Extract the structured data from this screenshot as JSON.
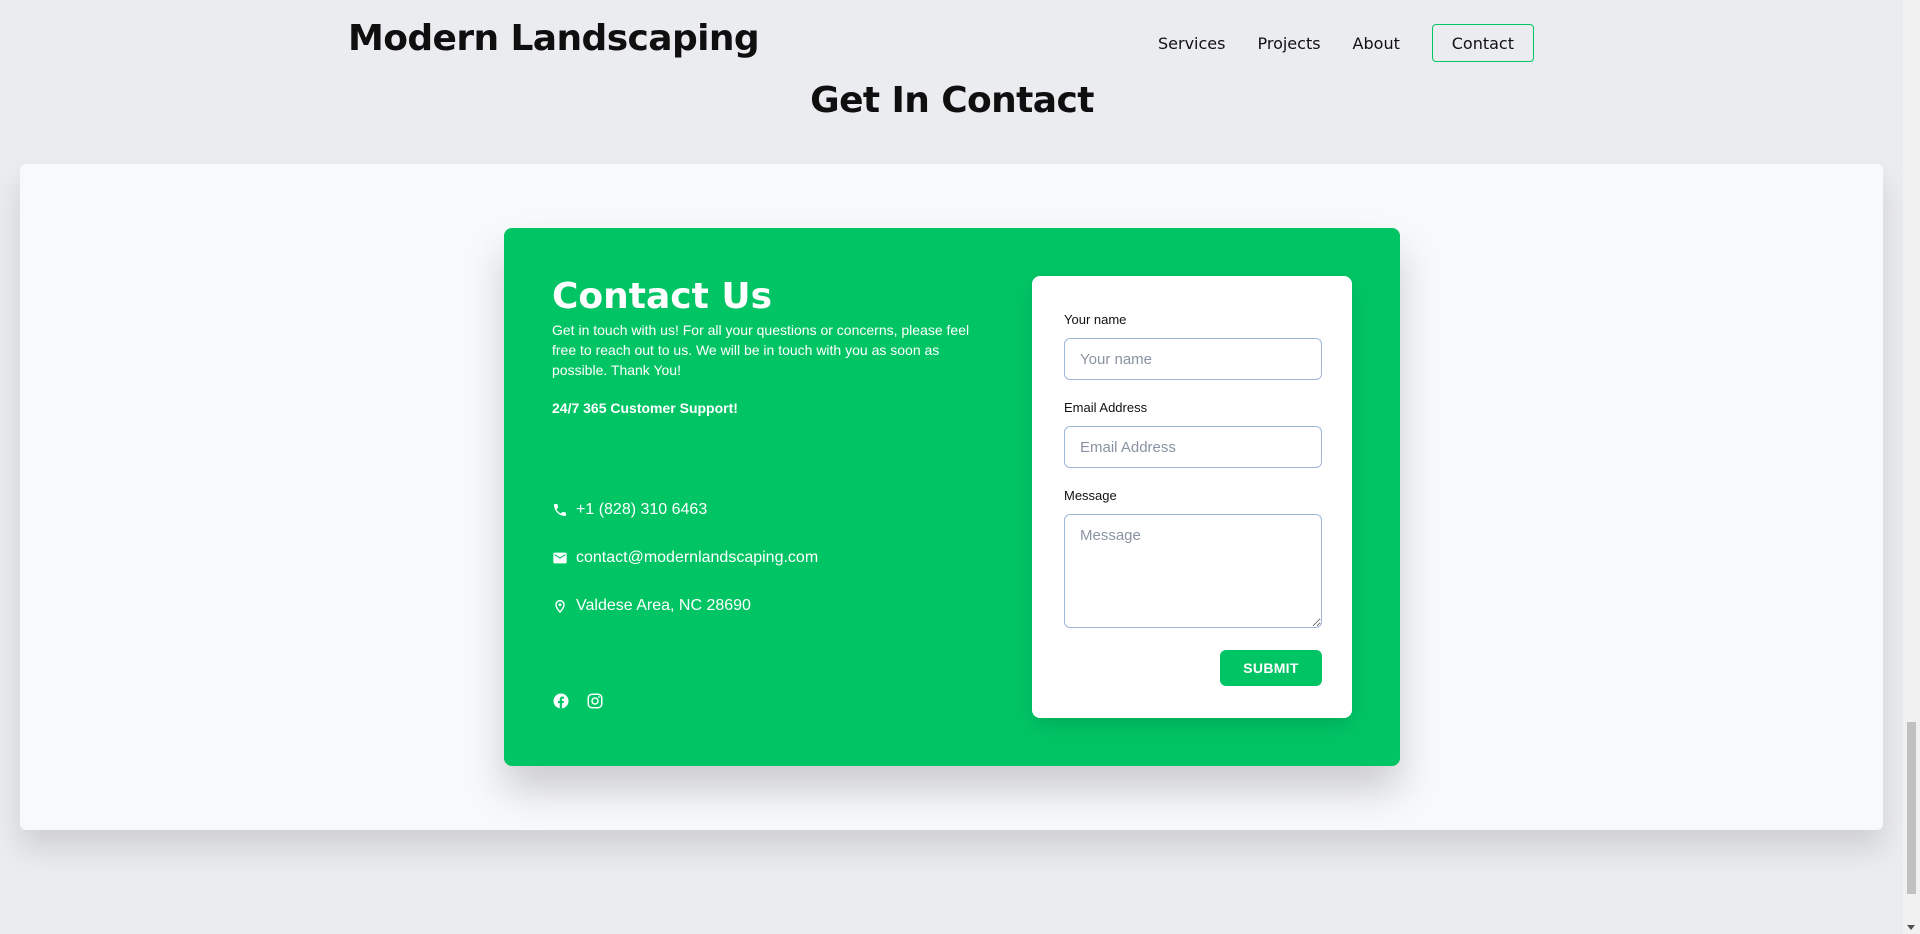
{
  "header": {
    "brand": "Modern Landscaping",
    "nav": [
      {
        "label": "Services"
      },
      {
        "label": "Projects"
      },
      {
        "label": "About"
      }
    ],
    "contact_button": "Contact"
  },
  "section": {
    "title": "Get In Contact"
  },
  "contact": {
    "title": "Contact Us",
    "description": "Get in touch with us! For all your questions or concerns, please feel free to reach out to us. We will be in touch with you as soon as possible. Thank You!",
    "support": "24/7 365 Customer Support!",
    "phone": "+1 (828) 310 6463",
    "email": "contact@modernlandscaping.com",
    "address": "Valdese Area, NC 28690",
    "icons": {
      "phone": "phone-icon",
      "email": "mail-icon",
      "address": "location-pin-icon",
      "social": [
        "facebook-icon",
        "instagram-icon"
      ]
    }
  },
  "form": {
    "name_label": "Your name",
    "name_placeholder": "Your name",
    "name_value": "",
    "email_label": "Email Address",
    "email_placeholder": "Email Address",
    "email_value": "",
    "message_label": "Message",
    "message_placeholder": "Message",
    "message_value": "",
    "submit_label": "SUBMIT"
  },
  "colors": {
    "accent": "#01c565",
    "background": "#ebecef",
    "panel": "#f8f9fb",
    "text": "#0f0f10"
  }
}
